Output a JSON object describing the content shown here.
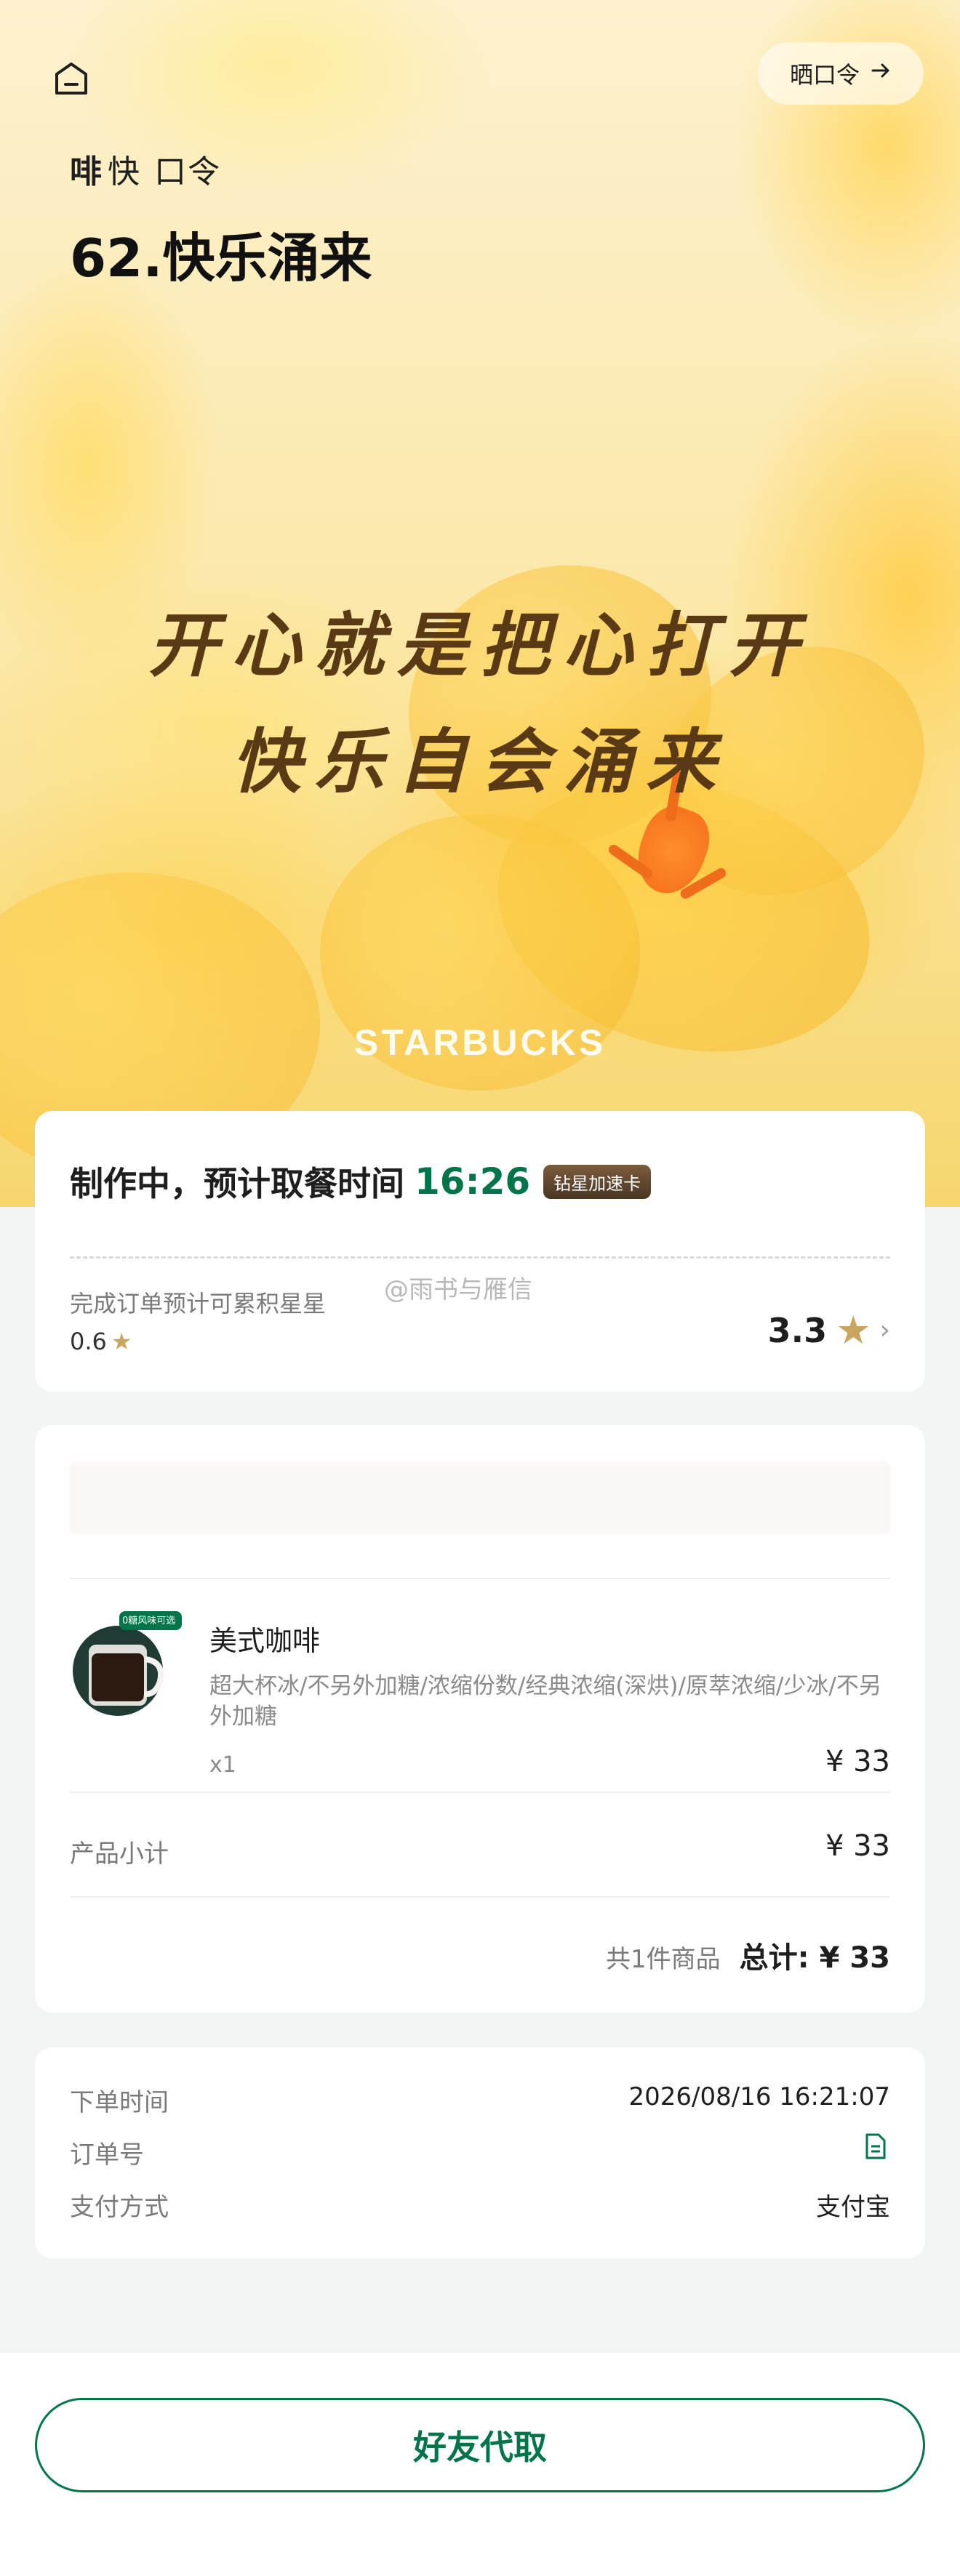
{
  "header": {
    "share_label": "晒口令",
    "brand_fei": "啡",
    "brand_kuai": "快",
    "brand_kouling": "口令",
    "code_title": "62.快乐涌来"
  },
  "hero": {
    "slogan_line1": "开心就是把心打开",
    "slogan_line2": "快乐自会涌来",
    "logo_text": "STARBUCKS"
  },
  "status": {
    "text": "制作中，预计取餐时间",
    "time": "16:26",
    "badge": "钻星加速卡",
    "stars_hint": "完成订单预计可累积星星",
    "stars_small": "0.6",
    "stars_total": "3.3"
  },
  "watermark": "@雨书与雁信",
  "order": {
    "product": {
      "name": "美式咖啡",
      "options": "超大杯冰/不另外加糖/浓缩份数/经典浓缩(深烘)/原萃浓缩/少冰/不另外加糖",
      "qty": "x1",
      "price": "¥ 33",
      "img_tag": "0糖风味可选"
    },
    "subtotal_label": "产品小计",
    "subtotal_value": "¥ 33",
    "total_count": "共1件商品",
    "total_value": "总计: ¥ 33"
  },
  "info": {
    "time_label": "下单时间",
    "time_value": "2026/08/16 16:21:07",
    "order_no_label": "订单号",
    "pay_label": "支付方式",
    "pay_value": "支付宝"
  },
  "bottom": {
    "friend_button": "好友代取"
  },
  "colors": {
    "brand_green": "#00754a",
    "star_gold": "#c9a560",
    "background": "#f2f5f4"
  }
}
